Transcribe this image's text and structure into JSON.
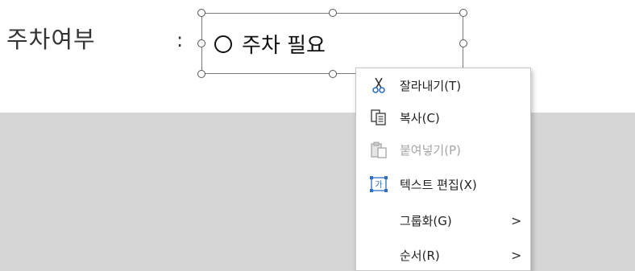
{
  "document": {
    "label": "주차여부",
    "colon": ":",
    "textbox_text": "주차 필요"
  },
  "context_menu": {
    "items": [
      {
        "label": "잘라내기(T)",
        "icon": "scissors-icon",
        "enabled": true
      },
      {
        "label": "복사(C)",
        "icon": "copy-icon",
        "enabled": true
      },
      {
        "label": "붙여넣기(P)",
        "icon": "paste-icon",
        "enabled": false
      },
      {
        "label": "텍스트 편집(X)",
        "icon": "edit-text-icon",
        "enabled": true,
        "highlighted": true
      },
      {
        "label": "그룹화(G)",
        "icon": "",
        "enabled": true,
        "submenu": true
      },
      {
        "label": "순서(R)",
        "icon": "",
        "enabled": true,
        "submenu": true
      }
    ],
    "submenu_glyph": ">"
  },
  "colors": {
    "highlight_border": "#d31414",
    "highlight_fill": "#fbe9e9",
    "icon_blue": "#2b6fc6",
    "background_gray": "#d6d6d6"
  }
}
